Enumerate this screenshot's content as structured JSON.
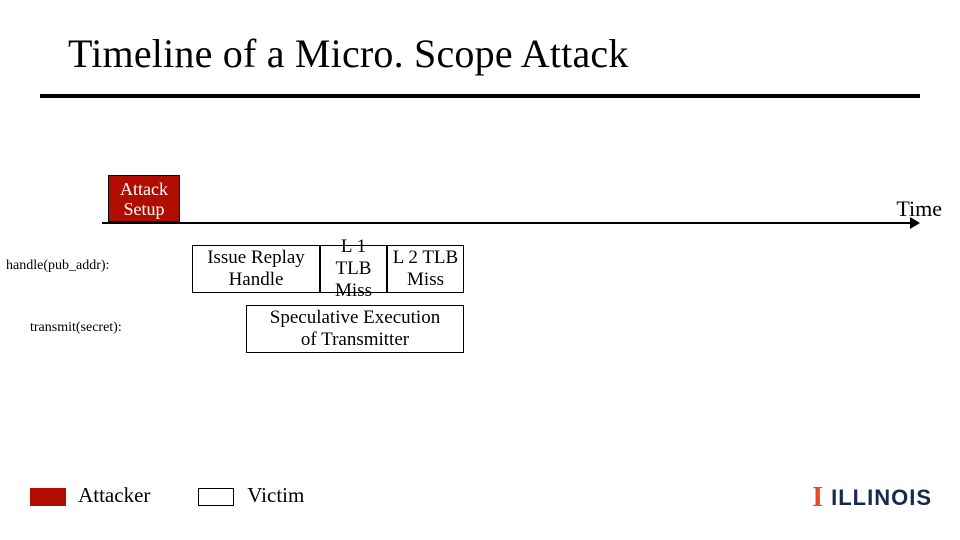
{
  "title": "Timeline of a Micro. Scope Attack",
  "time_label": "Time",
  "attack_setup": {
    "line1": "Attack",
    "line2": "Setup"
  },
  "row_labels": {
    "handle": "handle(pub_addr):",
    "transmit": "transmit(secret):"
  },
  "boxes": {
    "issue_replay": {
      "line1": "Issue Replay",
      "line2": "Handle"
    },
    "l1_tlb": {
      "line1": "L 1 TLB",
      "line2": "Miss"
    },
    "l2_tlb": {
      "line1": "L 2 TLB",
      "line2": "Miss"
    },
    "speculative": {
      "line1": "Speculative Execution",
      "line2": "of Transmitter"
    }
  },
  "legend": {
    "attacker": "Attacker",
    "victim": "Victim"
  },
  "footer_brand": {
    "prefix": "I",
    "name": "ILLINOIS"
  },
  "chart_data": {
    "type": "timeline",
    "axis": "Time",
    "tracks": [
      {
        "name": "setup",
        "actor": "Attacker",
        "events": [
          {
            "label": "Attack Setup",
            "start": 0,
            "end": 1,
            "color": "#b10c00"
          }
        ]
      },
      {
        "name": "handle(pub_addr)",
        "actor": "Victim",
        "events": [
          {
            "label": "Issue Replay Handle",
            "start": 1.2,
            "end": 2.9
          },
          {
            "label": "L 1 TLB Miss",
            "start": 2.9,
            "end": 3.8
          },
          {
            "label": "L 2 TLB Miss",
            "start": 3.8,
            "end": 4.8
          }
        ]
      },
      {
        "name": "transmit(secret)",
        "actor": "Victim",
        "events": [
          {
            "label": "Speculative Execution of Transmitter",
            "start": 1.9,
            "end": 4.8
          }
        ]
      }
    ],
    "legend": [
      {
        "label": "Attacker",
        "color": "#b10c00",
        "fill": "solid"
      },
      {
        "label": "Victim",
        "color": "#ffffff",
        "fill": "outline"
      }
    ]
  }
}
